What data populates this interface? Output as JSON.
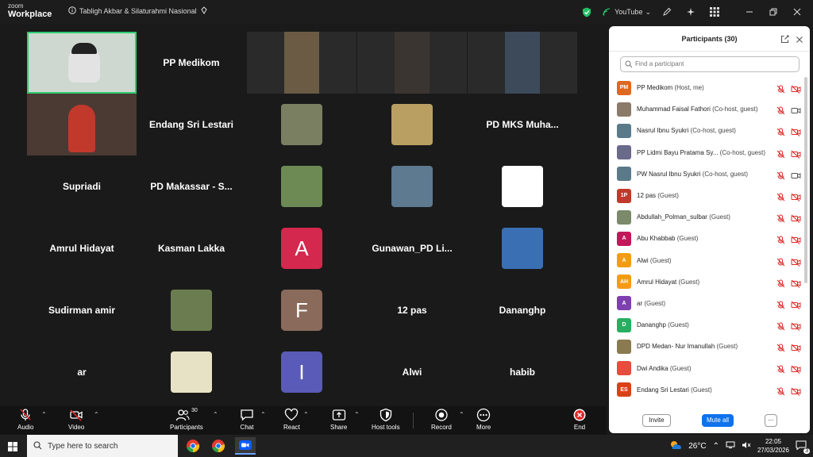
{
  "titlebar": {
    "logo_small": "zoom",
    "logo_big": "Workplace",
    "meeting_title": "Tabligh Akbar & Silaturahmi Nasional",
    "stream_label": "YouTube"
  },
  "stage": {
    "tiles": [
      {
        "type": "video",
        "name": "",
        "color": "#cfd8d0",
        "highlight": true
      },
      {
        "type": "name",
        "name": "PP Medikom"
      },
      {
        "type": "video",
        "name": "",
        "color": "#6b5a44"
      },
      {
        "type": "video",
        "name": "",
        "color": "#3b3531"
      },
      {
        "type": "video",
        "name": "",
        "color": "#3c4a5a"
      },
      {
        "type": "video",
        "name": "",
        "color": "#4a3a33"
      },
      {
        "type": "name",
        "name": "Endang Sri Lestari"
      },
      {
        "type": "thumb",
        "name": "",
        "color": "#7a7f62"
      },
      {
        "type": "thumb",
        "name": "",
        "color": "#b9a062"
      },
      {
        "type": "name",
        "name": "PD MKS Muha..."
      },
      {
        "type": "name",
        "name": "Supriadi"
      },
      {
        "type": "name",
        "name": "PD Makassar - S..."
      },
      {
        "type": "thumb",
        "name": "",
        "color": "#6d8a55"
      },
      {
        "type": "thumb",
        "name": "",
        "color": "#5d7a90"
      },
      {
        "type": "thumb",
        "name": "",
        "color": "#ffffff"
      },
      {
        "type": "name",
        "name": "Amrul Hidayat"
      },
      {
        "type": "name",
        "name": "Kasman Lakka"
      },
      {
        "type": "avatar",
        "name": "A",
        "color": "#d5284e"
      },
      {
        "type": "name",
        "name": "Gunawan_PD Li..."
      },
      {
        "type": "thumb",
        "name": "",
        "color": "#3a6fb3"
      },
      {
        "type": "name",
        "name": "Sudirman amir"
      },
      {
        "type": "thumb",
        "name": "",
        "color": "#6b7d50"
      },
      {
        "type": "avatar",
        "name": "F",
        "color": "#8a6a5a"
      },
      {
        "type": "name",
        "name": "12 pas"
      },
      {
        "type": "name",
        "name": "Dananghp"
      },
      {
        "type": "name",
        "name": "ar"
      },
      {
        "type": "thumb",
        "name": "",
        "color": "#e7e1c6"
      },
      {
        "type": "avatar",
        "name": "I",
        "color": "#5a5ab8"
      },
      {
        "type": "name",
        "name": "Alwi"
      },
      {
        "type": "name",
        "name": "habib"
      }
    ]
  },
  "toolbar": {
    "audio": "Audio",
    "video": "Video",
    "participants": "Participants",
    "participants_count": "30",
    "chat": "Chat",
    "react": "React",
    "share": "Share",
    "host_tools": "Host tools",
    "record": "Record",
    "more": "More",
    "end": "End"
  },
  "panel": {
    "title": "Participants (30)",
    "search_placeholder": "Find a participant",
    "participants": [
      {
        "initials": "PM",
        "color": "#e0671f",
        "name": "PP Medikom",
        "role": "(Host, me)",
        "video": "off"
      },
      {
        "initials": "",
        "color": "#8a7a6a",
        "name": "Muhammad Faisal Fathori",
        "role": "(Co-host, guest)",
        "video": "on"
      },
      {
        "initials": "",
        "color": "#5a7a8a",
        "name": "Nasrul Ibnu Syukri",
        "role": "(Co-host, guest)",
        "video": "off"
      },
      {
        "initials": "",
        "color": "#6a6a8a",
        "name": "PP Lidmi Bayu Pratama Sy...",
        "role": "(Co-host, guest)",
        "video": "off"
      },
      {
        "initials": "",
        "color": "#5a7a8a",
        "name": "PW Nasrul Ibnu Syukri",
        "role": "(Co-host, guest)",
        "video": "on"
      },
      {
        "initials": "1P",
        "color": "#c0392b",
        "name": "12 pas",
        "role": "(Guest)",
        "video": "off"
      },
      {
        "initials": "",
        "color": "#7a8a6a",
        "name": "Abdullah_Polman_sulbar",
        "role": "(Guest)",
        "video": "off"
      },
      {
        "initials": "A",
        "color": "#c2185b",
        "name": "Abu Khabbab",
        "role": "(Guest)",
        "video": "off"
      },
      {
        "initials": "A",
        "color": "#f39c12",
        "name": "Alwi",
        "role": "(Guest)",
        "video": "off"
      },
      {
        "initials": "AH",
        "color": "#f39c12",
        "name": "Amrul Hidayat",
        "role": "(Guest)",
        "video": "off"
      },
      {
        "initials": "A",
        "color": "#7e3fb0",
        "name": "ar",
        "role": "(Guest)",
        "video": "off"
      },
      {
        "initials": "D",
        "color": "#27ae60",
        "name": "Dananghp",
        "role": "(Guest)",
        "video": "off"
      },
      {
        "initials": "",
        "color": "#8a7a50",
        "name": "DPD Medan- Nur Imanullah",
        "role": "(Guest)",
        "video": "off"
      },
      {
        "initials": "",
        "color": "#e74c3c",
        "name": "Dwi Andika",
        "role": "(Guest)",
        "video": "off"
      },
      {
        "initials": "ES",
        "color": "#d84315",
        "name": "Endang Sri Lestari",
        "role": "(Guest)",
        "video": "off"
      }
    ],
    "invite": "Invite",
    "mute_all": "Mute all",
    "more": "..."
  },
  "taskbar": {
    "search_placeholder": "Type here to search",
    "temperature": "26°C",
    "time": "22:05",
    "date": "27/03/2026",
    "notification_count": "3"
  }
}
